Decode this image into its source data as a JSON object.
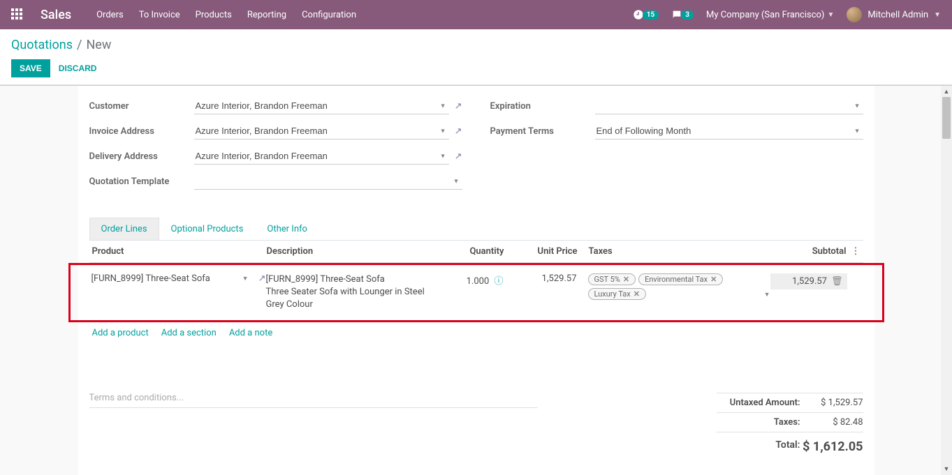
{
  "topbar": {
    "brand": "Sales",
    "nav": [
      "Orders",
      "To Invoice",
      "Products",
      "Reporting",
      "Configuration"
    ],
    "activity_count": "15",
    "messages_count": "3",
    "company": "My Company (San Francisco)",
    "user": "Mitchell Admin"
  },
  "breadcrumb": {
    "parent": "Quotations",
    "current": "New"
  },
  "buttons": {
    "save": "SAVE",
    "discard": "DISCARD"
  },
  "form": {
    "customer_label": "Customer",
    "customer_value": "Azure Interior, Brandon Freeman",
    "invoice_addr_label": "Invoice Address",
    "invoice_addr_value": "Azure Interior, Brandon Freeman",
    "delivery_addr_label": "Delivery Address",
    "delivery_addr_value": "Azure Interior, Brandon Freeman",
    "template_label": "Quotation Template",
    "template_value": "",
    "expiration_label": "Expiration",
    "expiration_value": "",
    "payment_terms_label": "Payment Terms",
    "payment_terms_value": "End of Following Month"
  },
  "tabs": [
    "Order Lines",
    "Optional Products",
    "Other Info"
  ],
  "columns": {
    "product": "Product",
    "description": "Description",
    "quantity": "Quantity",
    "unit_price": "Unit Price",
    "taxes": "Taxes",
    "subtotal": "Subtotal"
  },
  "line": {
    "product": "[FURN_8999] Three-Seat Sofa",
    "desc_line1": "[FURN_8999] Three-Seat Sofa",
    "desc_line2": "Three Seater Sofa with Lounger in Steel Grey Colour",
    "qty": "1.000",
    "unit_price": "1,529.57",
    "taxes": [
      "GST 5%",
      "Environmental Tax",
      "Luxury Tax"
    ],
    "subtotal": "1,529.57"
  },
  "add_links": {
    "product": "Add a product",
    "section": "Add a section",
    "note": "Add a note"
  },
  "terms_placeholder": "Terms and conditions...",
  "totals": {
    "untaxed_label": "Untaxed Amount:",
    "untaxed_value": "$ 1,529.57",
    "taxes_label": "Taxes:",
    "taxes_value": "$ 82.48",
    "total_label": "Total:",
    "total_value": "$ 1,612.05"
  }
}
